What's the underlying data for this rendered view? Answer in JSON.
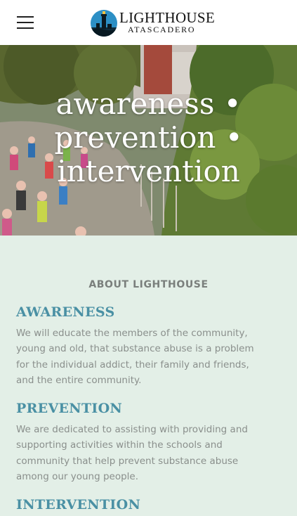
{
  "header": {
    "menu_icon": "hamburger-menu-icon",
    "logo_icon": "lighthouse-logo-icon",
    "logo_name": "LIGHTHOUSE",
    "logo_sub": "ATASCADERO"
  },
  "hero": {
    "line1": "awareness •",
    "line2": "prevention •",
    "line3": "intervention"
  },
  "about": {
    "heading": "ABOUT LIGHTHOUSE",
    "sections": [
      {
        "title": "AWARENESS",
        "body": "We will educate the members of the community, young and old, that substance abuse is a problem for the individual addict, their family and friends, and the entire community."
      },
      {
        "title": "PREVENTION",
        "body": "We are dedicated to assisting with providing and supporting activities within the schools and community that help prevent substance abuse among our young people."
      },
      {
        "title": "INTERVENTION"
      }
    ]
  },
  "colors": {
    "accent": "#4a90a4",
    "about_bg": "#e3efe7",
    "body_text": "#8a8f8c"
  }
}
